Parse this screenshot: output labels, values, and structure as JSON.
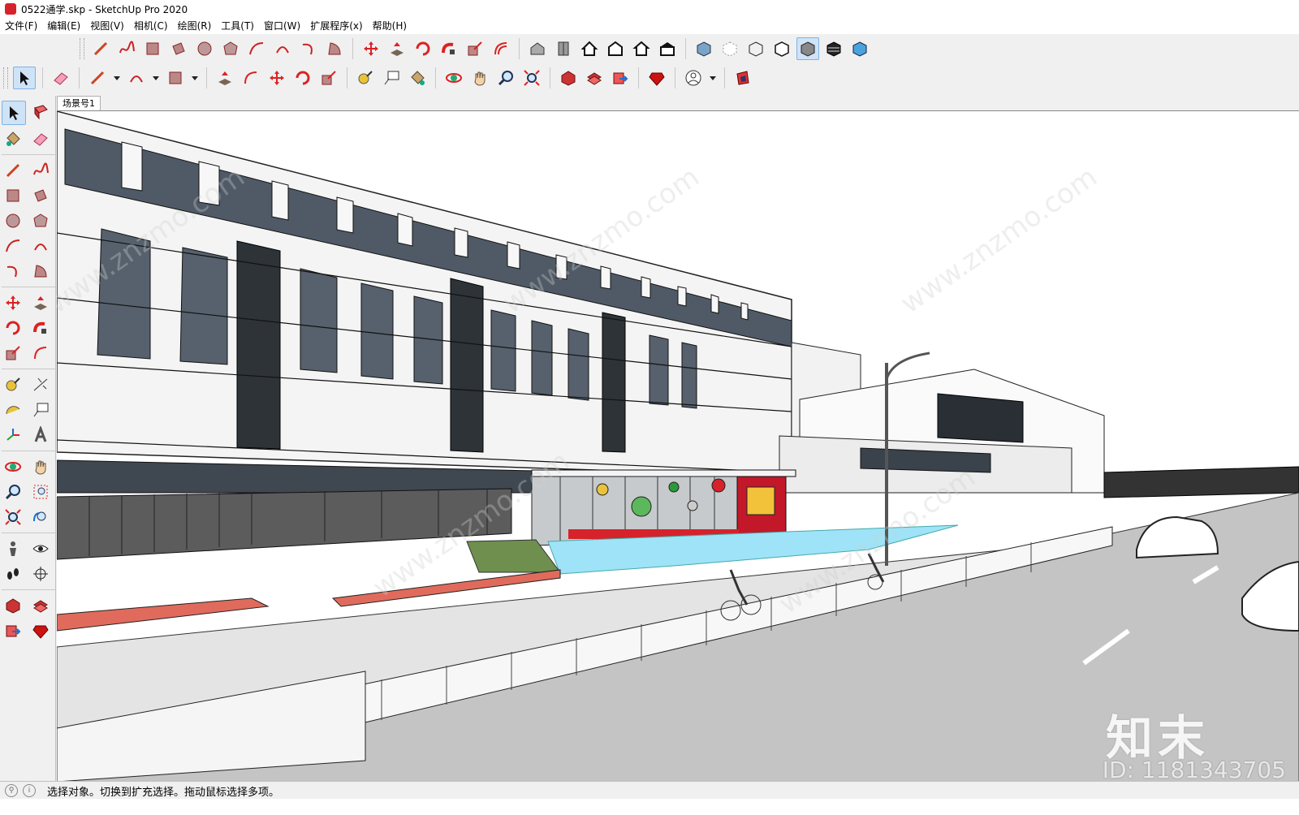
{
  "window": {
    "title": "0522通学.skp - SketchUp Pro 2020"
  },
  "menu": [
    "文件(F)",
    "编辑(E)",
    "视图(V)",
    "相机(C)",
    "绘图(R)",
    "工具(T)",
    "窗口(W)",
    "扩展程序(x)",
    "帮助(H)"
  ],
  "scene_tabs": [
    "场景号1"
  ],
  "status": {
    "text": "选择对象。切换到扩充选择。拖动鼠标选择多项。"
  },
  "watermark": {
    "logo": "知末",
    "id": "ID: 1181343705",
    "site": "www.znzmo.com"
  },
  "colors": {
    "accent_red": "#d6222a",
    "toolbar_bg": "#f0f0f0",
    "selected_tool": "#cfe3f7"
  }
}
